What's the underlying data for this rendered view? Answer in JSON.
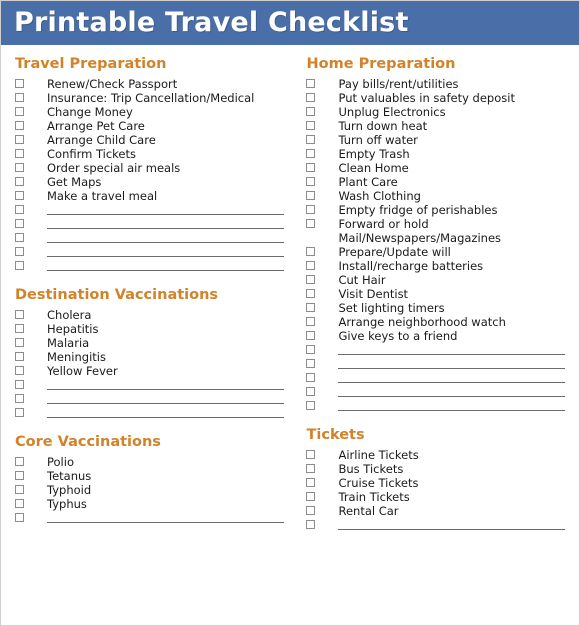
{
  "header": {
    "title": "Printable Travel Checklist",
    "background_color": "#4a6fa8",
    "text_color": "#ffffff"
  },
  "theme": {
    "heading_color": "#d2832a",
    "text_color": "#1a1a1a",
    "checkbox_border_color": "#8c8c8c",
    "rule_color": "#6a6a6a",
    "page_border_color": "#cfcfcf"
  },
  "left_column": {
    "sections": [
      {
        "heading": "Travel Preparation",
        "items": [
          {
            "label": "Renew/Check Passport",
            "blank": false
          },
          {
            "label": "Insurance: Trip Cancellation/Medical",
            "blank": false
          },
          {
            "label": "Change Money",
            "blank": false
          },
          {
            "label": "Arrange Pet Care",
            "blank": false
          },
          {
            "label": "Arrange Child Care",
            "blank": false
          },
          {
            "label": "Confirm Tickets",
            "blank": false
          },
          {
            "label": "Order special air meals",
            "blank": false
          },
          {
            "label": "Get Maps",
            "blank": false
          },
          {
            "label": "Make a travel meal",
            "blank": false
          },
          {
            "label": "",
            "blank": true
          },
          {
            "label": "",
            "blank": true
          },
          {
            "label": "",
            "blank": true
          },
          {
            "label": "",
            "blank": true
          },
          {
            "label": "",
            "blank": true
          }
        ]
      },
      {
        "heading": "Destination Vaccinations",
        "items": [
          {
            "label": "Cholera",
            "blank": false
          },
          {
            "label": "Hepatitis",
            "blank": false
          },
          {
            "label": "Malaria",
            "blank": false
          },
          {
            "label": "Meningitis",
            "blank": false
          },
          {
            "label": "Yellow Fever",
            "blank": false
          },
          {
            "label": "",
            "blank": true
          },
          {
            "label": "",
            "blank": true
          },
          {
            "label": "",
            "blank": true
          }
        ]
      },
      {
        "heading": "Core Vaccinations",
        "items": [
          {
            "label": "Polio",
            "blank": false
          },
          {
            "label": "Tetanus",
            "blank": false
          },
          {
            "label": "Typhoid",
            "blank": false
          },
          {
            "label": "Typhus",
            "blank": false
          },
          {
            "label": "",
            "blank": true
          }
        ]
      }
    ]
  },
  "right_column": {
    "sections": [
      {
        "heading": "Home Preparation",
        "items": [
          {
            "label": "Pay bills/rent/utilities",
            "blank": false
          },
          {
            "label": "Put valuables in safety deposit",
            "blank": false
          },
          {
            "label": "Unplug Electronics",
            "blank": false
          },
          {
            "label": "Turn down heat",
            "blank": false
          },
          {
            "label": "Turn off water",
            "blank": false
          },
          {
            "label": "Empty Trash",
            "blank": false
          },
          {
            "label": "Clean Home",
            "blank": false
          },
          {
            "label": "Plant Care",
            "blank": false
          },
          {
            "label": "Wash Clothing",
            "blank": false
          },
          {
            "label": "Empty fridge of perishables",
            "blank": false
          },
          {
            "label": "Forward or hold\nMail/Newspapers/Magazines",
            "blank": false
          },
          {
            "label": "Prepare/Update will",
            "blank": false
          },
          {
            "label": "Install/recharge batteries",
            "blank": false
          },
          {
            "label": "Cut Hair",
            "blank": false
          },
          {
            "label": "Visit Dentist",
            "blank": false
          },
          {
            "label": "Set lighting timers",
            "blank": false
          },
          {
            "label": "Arrange neighborhood watch",
            "blank": false
          },
          {
            "label": "Give keys to a friend",
            "blank": false
          },
          {
            "label": "",
            "blank": true
          },
          {
            "label": "",
            "blank": true
          },
          {
            "label": "",
            "blank": true
          },
          {
            "label": "",
            "blank": true
          },
          {
            "label": "",
            "blank": true
          }
        ]
      },
      {
        "heading": "Tickets",
        "items": [
          {
            "label": "Airline Tickets",
            "blank": false
          },
          {
            "label": "Bus Tickets",
            "blank": false
          },
          {
            "label": "Cruise Tickets",
            "blank": false
          },
          {
            "label": "Train Tickets",
            "blank": false
          },
          {
            "label": "Rental Car",
            "blank": false
          },
          {
            "label": "",
            "blank": true
          }
        ]
      }
    ]
  }
}
